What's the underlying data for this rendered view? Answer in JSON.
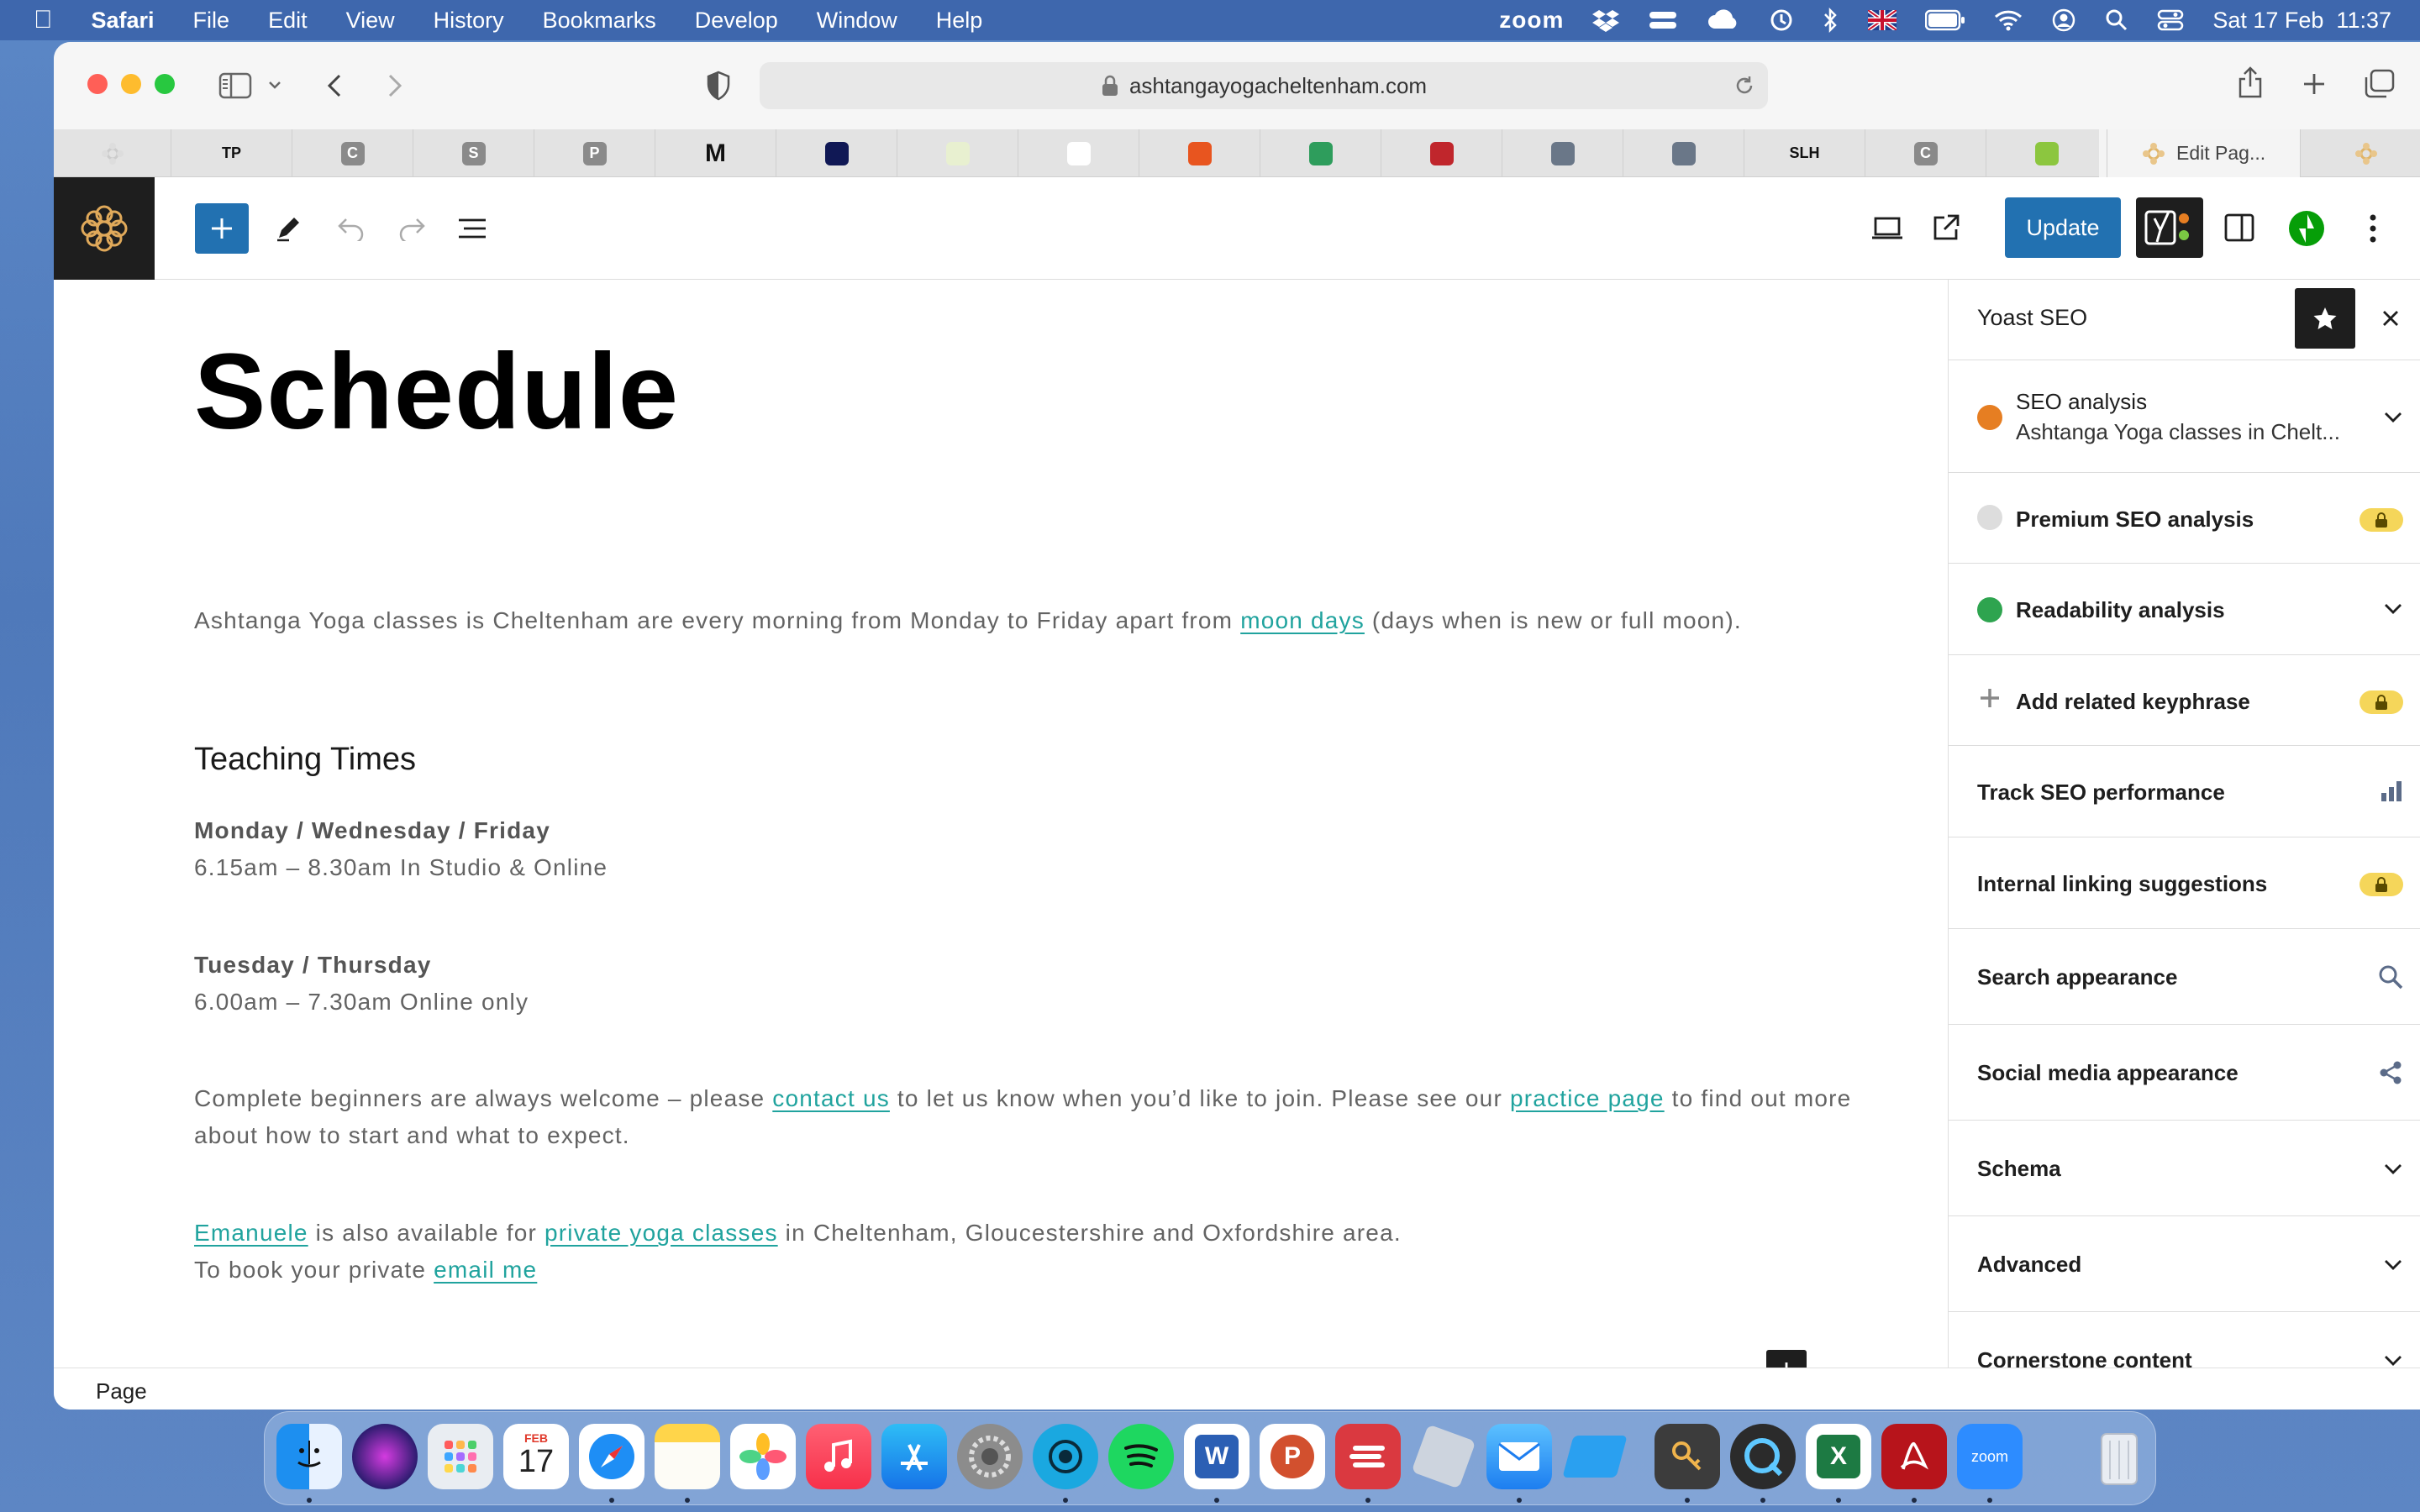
{
  "menubar": {
    "app": "Safari",
    "items": [
      "File",
      "Edit",
      "View",
      "History",
      "Bookmarks",
      "Develop",
      "Window",
      "Help"
    ],
    "zoom": "zoom",
    "datetime": "Sat 17 Feb  11:37"
  },
  "browser": {
    "url": "ashtangayogacheltenham.com",
    "active_tab": "Edit Pag...",
    "tabs": [
      {
        "text": "TP",
        "color": "#f1f1f1"
      },
      {
        "text": "C",
        "color": "#8a8a8a"
      },
      {
        "text": "S",
        "color": "#8a8a8a"
      },
      {
        "text": "P",
        "color": "#8a8a8a"
      },
      {
        "text": "M",
        "color": "#f1f1f1"
      },
      {
        "text": "",
        "color": "#101855"
      },
      {
        "text": "",
        "color": "#e8f0d0"
      },
      {
        "text": "",
        "color": "#ffffff"
      },
      {
        "text": "",
        "color": "#e8551f"
      },
      {
        "text": "",
        "color": "#2e9d5c"
      },
      {
        "text": "",
        "color": "#c0262c"
      },
      {
        "text": "",
        "color": "#6a7788"
      },
      {
        "text": "",
        "color": "#6a7788"
      },
      {
        "text": "SLH",
        "color": "#f1f1f1"
      },
      {
        "text": "C",
        "color": "#8a8a8a"
      },
      {
        "text": "",
        "color": "#8cc63f"
      }
    ]
  },
  "editor": {
    "update_label": "Update",
    "status_label": "Page"
  },
  "page": {
    "title": "Schedule",
    "intro_a": "Ashtanga Yoga classes is Cheltenham are every morning from Monday to Friday apart from ",
    "intro_link": "moon days",
    "intro_b": " (days when is new or full moon).",
    "heading": "Teaching Times",
    "s1_days": "Monday / Wednesday / Friday",
    "s1_time": "6.15am – 8.30am In Studio & Online",
    "s2_days": "Tuesday / Thursday",
    "s2_time": "6.00am – 7.30am Online only",
    "beg_a": "Complete beginners are always welcome – please ",
    "beg_link1": "contact us",
    "beg_b": " to let us know when you’d like to join. Please see our ",
    "beg_link2": "practice page",
    "beg_c": " to find out more about how to start and what to expect.",
    "priv_link1": "Emanuele",
    "priv_a": " is also available for ",
    "priv_link2": "private yoga classes",
    "priv_b": " in Cheltenham, Gloucestershire and Oxfordshire area.",
    "priv_c": "To book your private ",
    "priv_link3": "email me"
  },
  "sidebar": {
    "title": "Yoast SEO",
    "seo_analysis": "SEO analysis",
    "seo_analysis_sub": "Ashtanga Yoga classes in Chelt...",
    "premium": "Premium SEO analysis",
    "readability": "Readability analysis",
    "related": "Add related keyphrase",
    "track": "Track SEO performance",
    "internal": "Internal linking suggestions",
    "search": "Search appearance",
    "social": "Social media appearance",
    "schema": "Schema",
    "advanced": "Advanced",
    "cornerstone": "Cornerstone content"
  },
  "colors": {
    "accent": "#2271b1",
    "link": "#20a39e",
    "seo_status": "#e67e22",
    "readability_status": "#2ea44f"
  },
  "dock": {
    "calendar_month": "FEB",
    "calendar_day": "17",
    "apps": [
      "finder-icon",
      "siri-icon",
      "launchpad-icon",
      "calendar-icon",
      "safari-icon",
      "notes-icon",
      "photos-icon",
      "music-icon",
      "app-store-icon",
      "system-settings-icon",
      "camo-icon",
      "spotify-icon",
      "word-icon",
      "powerpoint-icon",
      "expressvpn-icon",
      "paw-icon",
      "mail-icon",
      "cursor-icon",
      "keychain-icon",
      "quicktime-icon",
      "excel-icon",
      "acrobat-icon",
      "zoom-icon",
      "trash-icon"
    ]
  }
}
